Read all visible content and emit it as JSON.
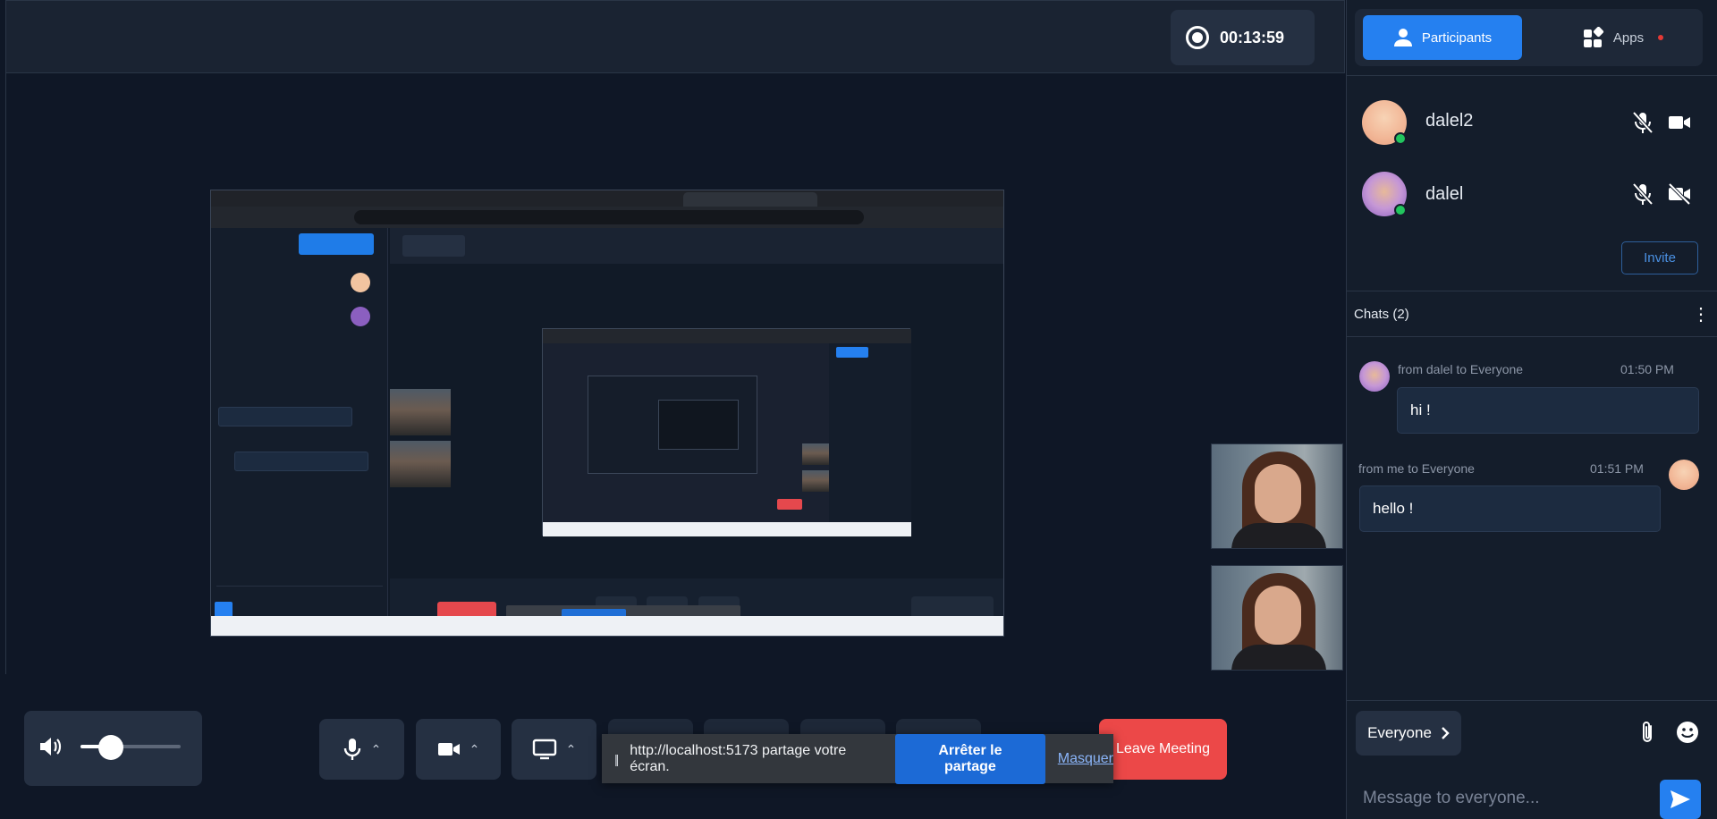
{
  "timer": {
    "elapsed": "00:13:59"
  },
  "tabs": {
    "participants": "Participants",
    "apps": "Apps"
  },
  "participants": [
    {
      "name": "dalel2",
      "mic": "muted",
      "camera": "on"
    },
    {
      "name": "dalel",
      "mic": "muted",
      "camera": "off"
    }
  ],
  "invite_label": "Invite",
  "chats": {
    "title": "Chats (2)",
    "messages": [
      {
        "meta": "from dalel to Everyone",
        "time": "01:50 PM",
        "text": "hi !"
      },
      {
        "meta": "from me to Everyone",
        "time": "01:51 PM",
        "text": "hello !"
      }
    ]
  },
  "composer": {
    "recipient": "Everyone",
    "placeholder": "Message to everyone..."
  },
  "controls": {
    "leave_label": "Leave Meeting"
  },
  "volume": {
    "level": 0.3
  },
  "share_banner": {
    "text": "http://localhost:5173 partage votre écran.",
    "stop_label": "Arrêter le partage",
    "hide_label": "Masquer"
  },
  "colors": {
    "accent": "#2580f0",
    "leave": "#ec4848",
    "online": "#22c55e",
    "panel": "#141d2b"
  }
}
